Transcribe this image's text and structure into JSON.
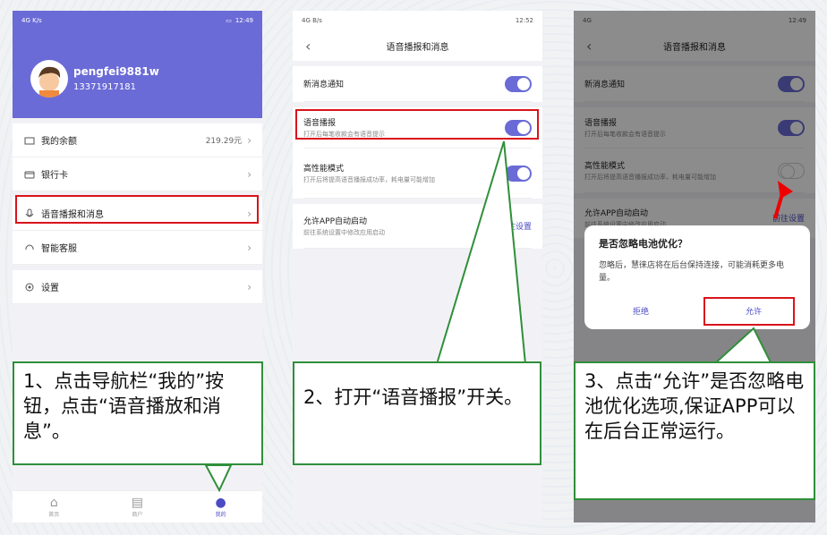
{
  "status1": {
    "left": "4G  K/s",
    "time": "12:49"
  },
  "status2": {
    "left": "4G  B/s",
    "time": "12:52"
  },
  "status3": {
    "left": "4G",
    "time": "12:49"
  },
  "profile": {
    "username": "pengfei9881w",
    "phone": "13371917181"
  },
  "menu": [
    {
      "label": "我的余额",
      "value": "219.29元",
      "icon": "wallet-icon"
    },
    {
      "label": "银行卡",
      "value": "",
      "icon": "card-icon"
    },
    {
      "label": "语音播报和消息",
      "value": "",
      "icon": "microphone-icon"
    },
    {
      "label": "智能客服",
      "value": "",
      "icon": "headset-icon"
    },
    {
      "label": "设置",
      "value": "",
      "icon": "gear-icon"
    }
  ],
  "tabs": [
    {
      "label": "首页",
      "icon": "home-icon"
    },
    {
      "label": "商户",
      "icon": "store-icon"
    },
    {
      "label": "我的",
      "icon": "person-icon"
    }
  ],
  "settings_title": "语音播报和消息",
  "settings": {
    "new_msg": "新消息通知",
    "voice": {
      "title": "语音播报",
      "sub": "打开后每笔收款会有语音提示"
    },
    "hiperf": {
      "title": "高性能模式",
      "sub": "打开后将提高语音播报成功率，耗电量可能增加"
    },
    "autostart": {
      "title": "允许APP自动启动",
      "sub": "前往系统设置中修改应用启动",
      "action": "前往设置"
    }
  },
  "dialog": {
    "title": "是否忽略电池优化？",
    "body": "忽略后，慧徕店将在后台保持连接，可能消耗更多电量。",
    "reject": "拒绝",
    "allow": "允许"
  },
  "callouts": {
    "c1": "1、点击导航栏“我的”按钮，点击“语音播放和消息”。",
    "c2": "2、打开“语音播报”开关。",
    "c3": "3、点击“允许”是否忽略电池优化选项,保证APP可以在后台正常运行。"
  },
  "colors": {
    "accent": "#6a6bd6",
    "highlight": "#d9141b",
    "callout_border": "#2f8f3a"
  }
}
